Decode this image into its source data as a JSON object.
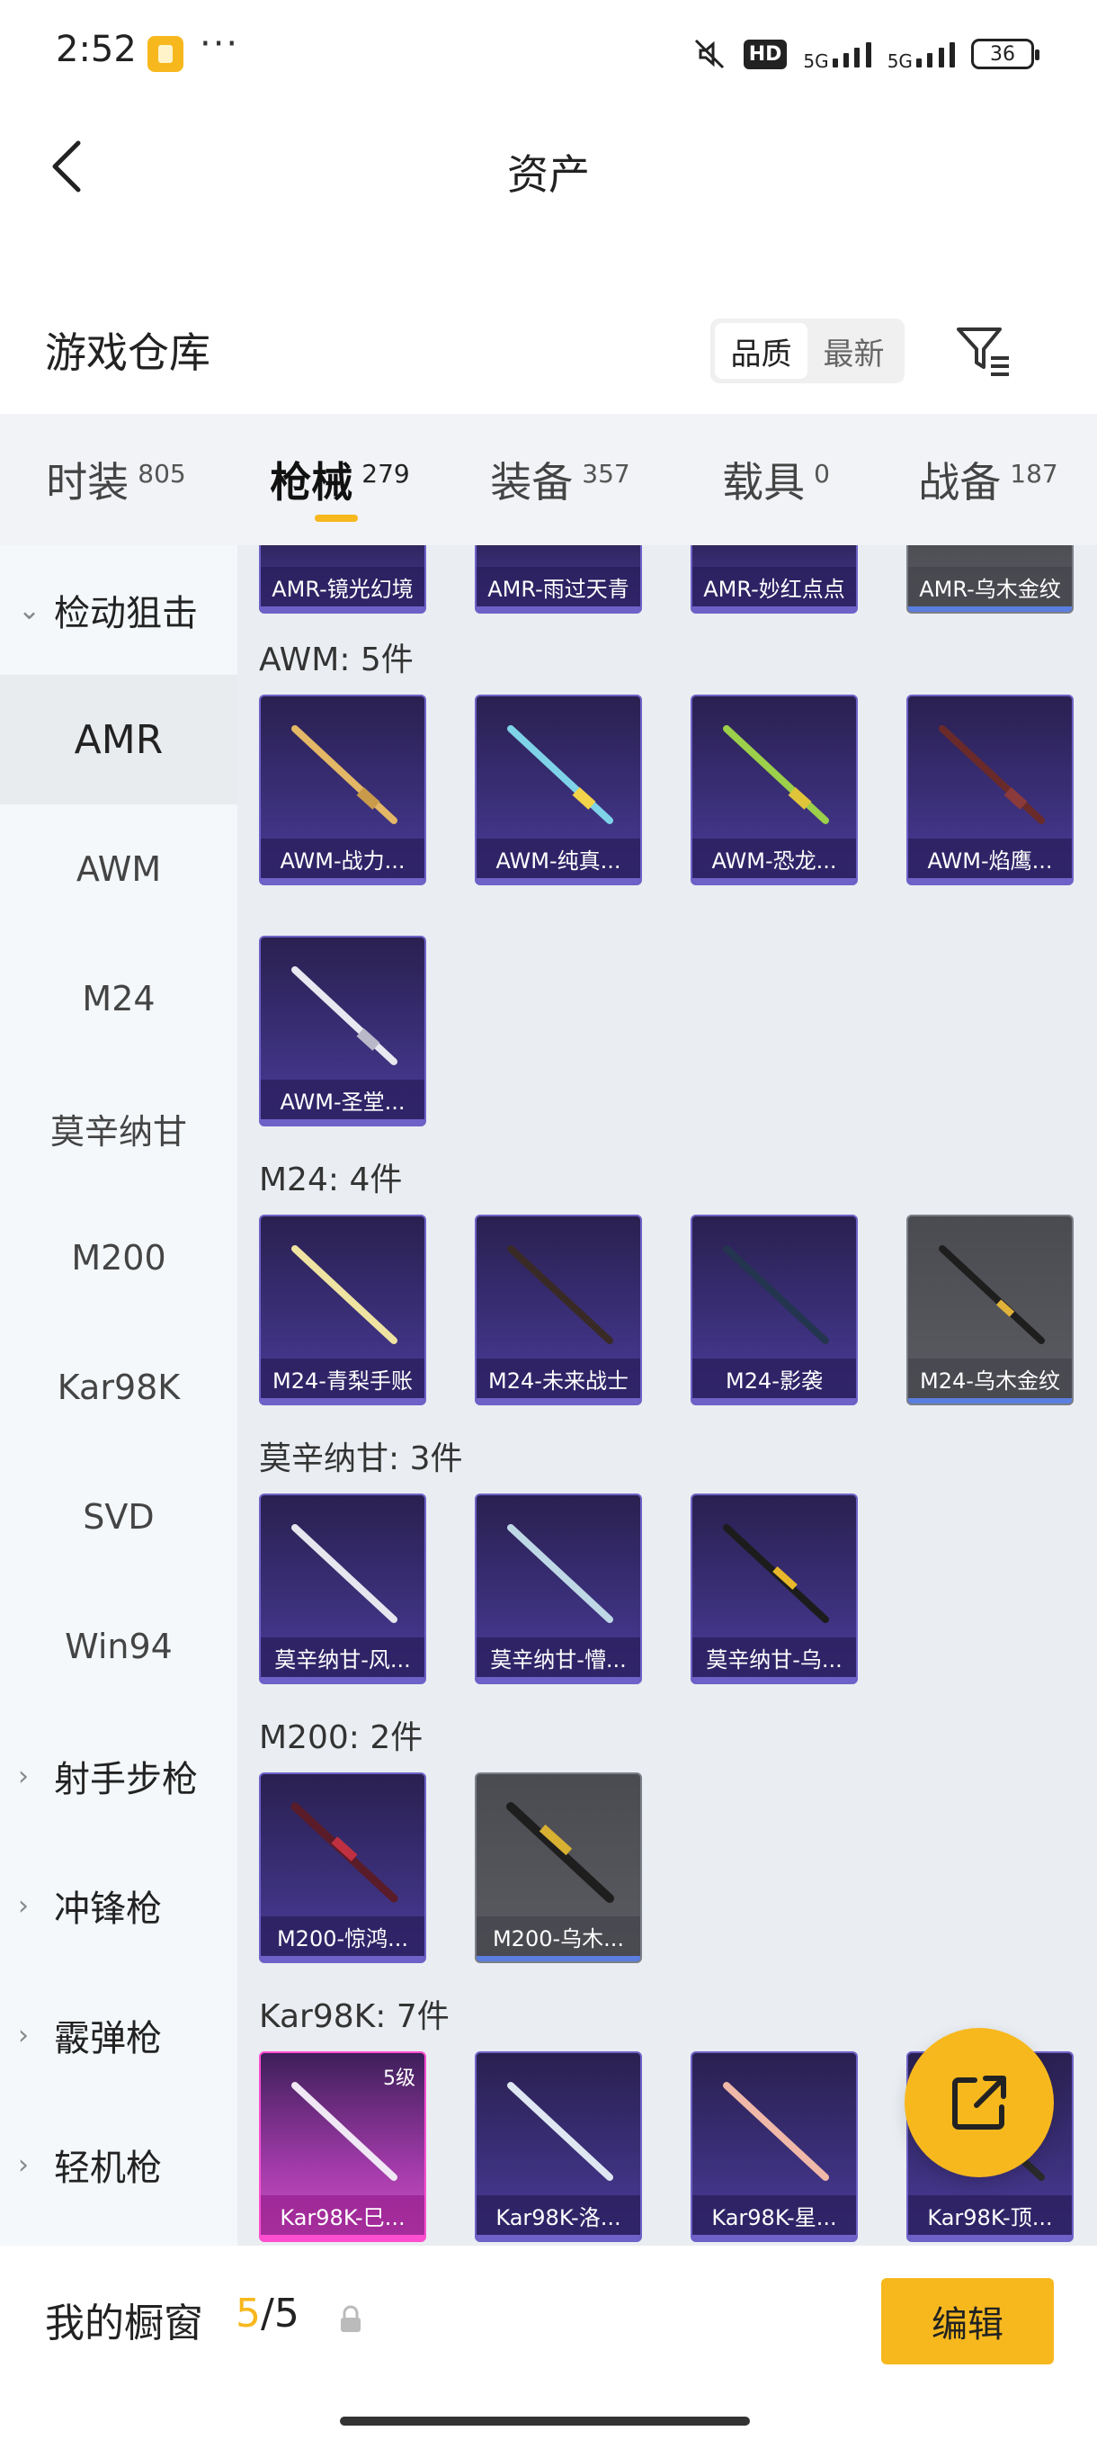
{
  "status": {
    "time": "2:52",
    "more": "···",
    "hd": "HD",
    "net1": "5G",
    "net2": "5G",
    "battery": "36"
  },
  "header": {
    "title": "资产",
    "back_icon": "back-arrow-icon"
  },
  "section": {
    "title": "游戏仓库",
    "sort_quality": "品质",
    "sort_newest": "最新",
    "filter_icon": "filter-icon"
  },
  "tabs": [
    {
      "label": "时装",
      "count": "805"
    },
    {
      "label": "枪械",
      "count": "279"
    },
    {
      "label": "装备",
      "count": "357"
    },
    {
      "label": "载具",
      "count": "0"
    },
    {
      "label": "战备",
      "count": "187"
    }
  ],
  "sidebar": {
    "category_open": "检动狙击",
    "items": [
      "AMR",
      "AWM",
      "M24",
      "莫辛纳甘",
      "M200",
      "Kar98K",
      "SVD",
      "Win94"
    ],
    "categories": [
      "射手步枪",
      "冲锋枪",
      "霰弹枪",
      "轻机枪"
    ]
  },
  "groups": {
    "amr_cards": [
      "AMR-镜光幻境",
      "AMR-雨过天青",
      "AMR-妙红点点",
      "AMR-乌木金纹"
    ],
    "awm_label": "AWM: 5件",
    "awm_cards": [
      "AWM-战力...",
      "AWM-纯真...",
      "AWM-恐龙...",
      "AWM-焰鹰...",
      "AWM-圣堂..."
    ],
    "m24_label": "M24: 4件",
    "m24_cards": [
      "M24-青梨手账",
      "M24-未来战士",
      "M24-影袭",
      "M24-乌木金纹"
    ],
    "mosin_label": "莫辛纳甘: 3件",
    "mosin_cards": [
      "莫辛纳甘-风...",
      "莫辛纳甘-懵...",
      "莫辛纳甘-乌..."
    ],
    "m200_label": "M200: 2件",
    "m200_cards": [
      "M200-惊鸿...",
      "M200-乌木..."
    ],
    "kar_label": "Kar98K: 7件",
    "kar_cards": [
      "Kar98K-巳...",
      "Kar98K-洛...",
      "Kar98K-星...",
      "Kar98K-顶..."
    ],
    "kar_level": "5级"
  },
  "bottom": {
    "label": "我的橱窗",
    "current": "5",
    "sep_total": "/5",
    "edit": "编辑"
  },
  "colors": {
    "accent": "#f7b81e",
    "card_purple": "#3a2f78",
    "card_gray": "#5b5c62",
    "card_pink": "#d052c4"
  }
}
